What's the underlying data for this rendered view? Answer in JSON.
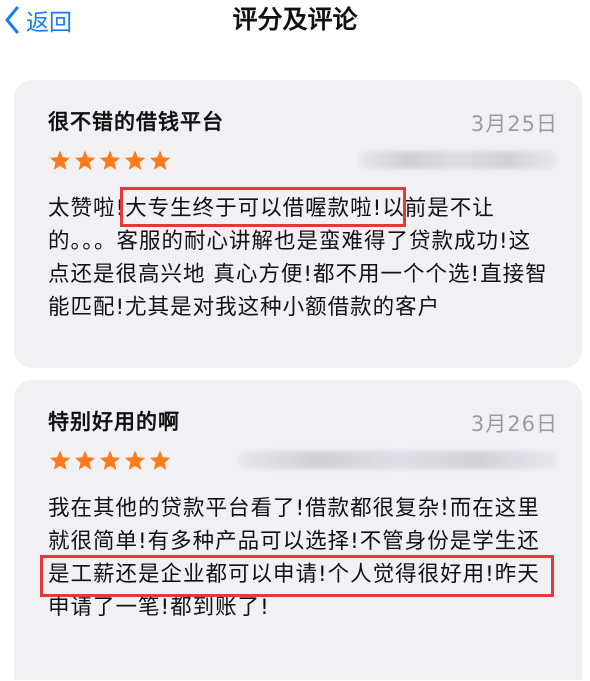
{
  "nav": {
    "back_label": "返回",
    "title": "评分及评论"
  },
  "reviews": [
    {
      "title": "很不错的借钱平台",
      "date": "3月25日",
      "rating": 5,
      "author_blurred": true,
      "body": "太赞啦!大专生终于可以借喔款啦!以前是不让的。。。客服的耐心讲解也是蛮难得了贷款成功!这点还是很高兴地 真心方便!都不用一个个选!直接智能匹配!尤其是对我这种小额借款的客户",
      "highlight": "大专生终于可以借喔款啦!"
    },
    {
      "title": "特别好用的啊",
      "date": "3月26日",
      "rating": 5,
      "author_blurred": true,
      "body": "我在其他的贷款平台看了!借款都很复杂!而在这里就很简单!有多种产品可以选择!不管身份是学生还是工薪还是企业都可以申请!个人觉得很好用!昨天申请了一笔!都到账了!",
      "highlight": "身份是学生还是工薪还是企业都可以申请!"
    }
  ],
  "colors": {
    "accent": "#1a7cf5",
    "star": "#ff7a1a",
    "highlight_box": "#e53935",
    "card_bg": "#f1f1f4",
    "date": "#9a9aa0"
  }
}
